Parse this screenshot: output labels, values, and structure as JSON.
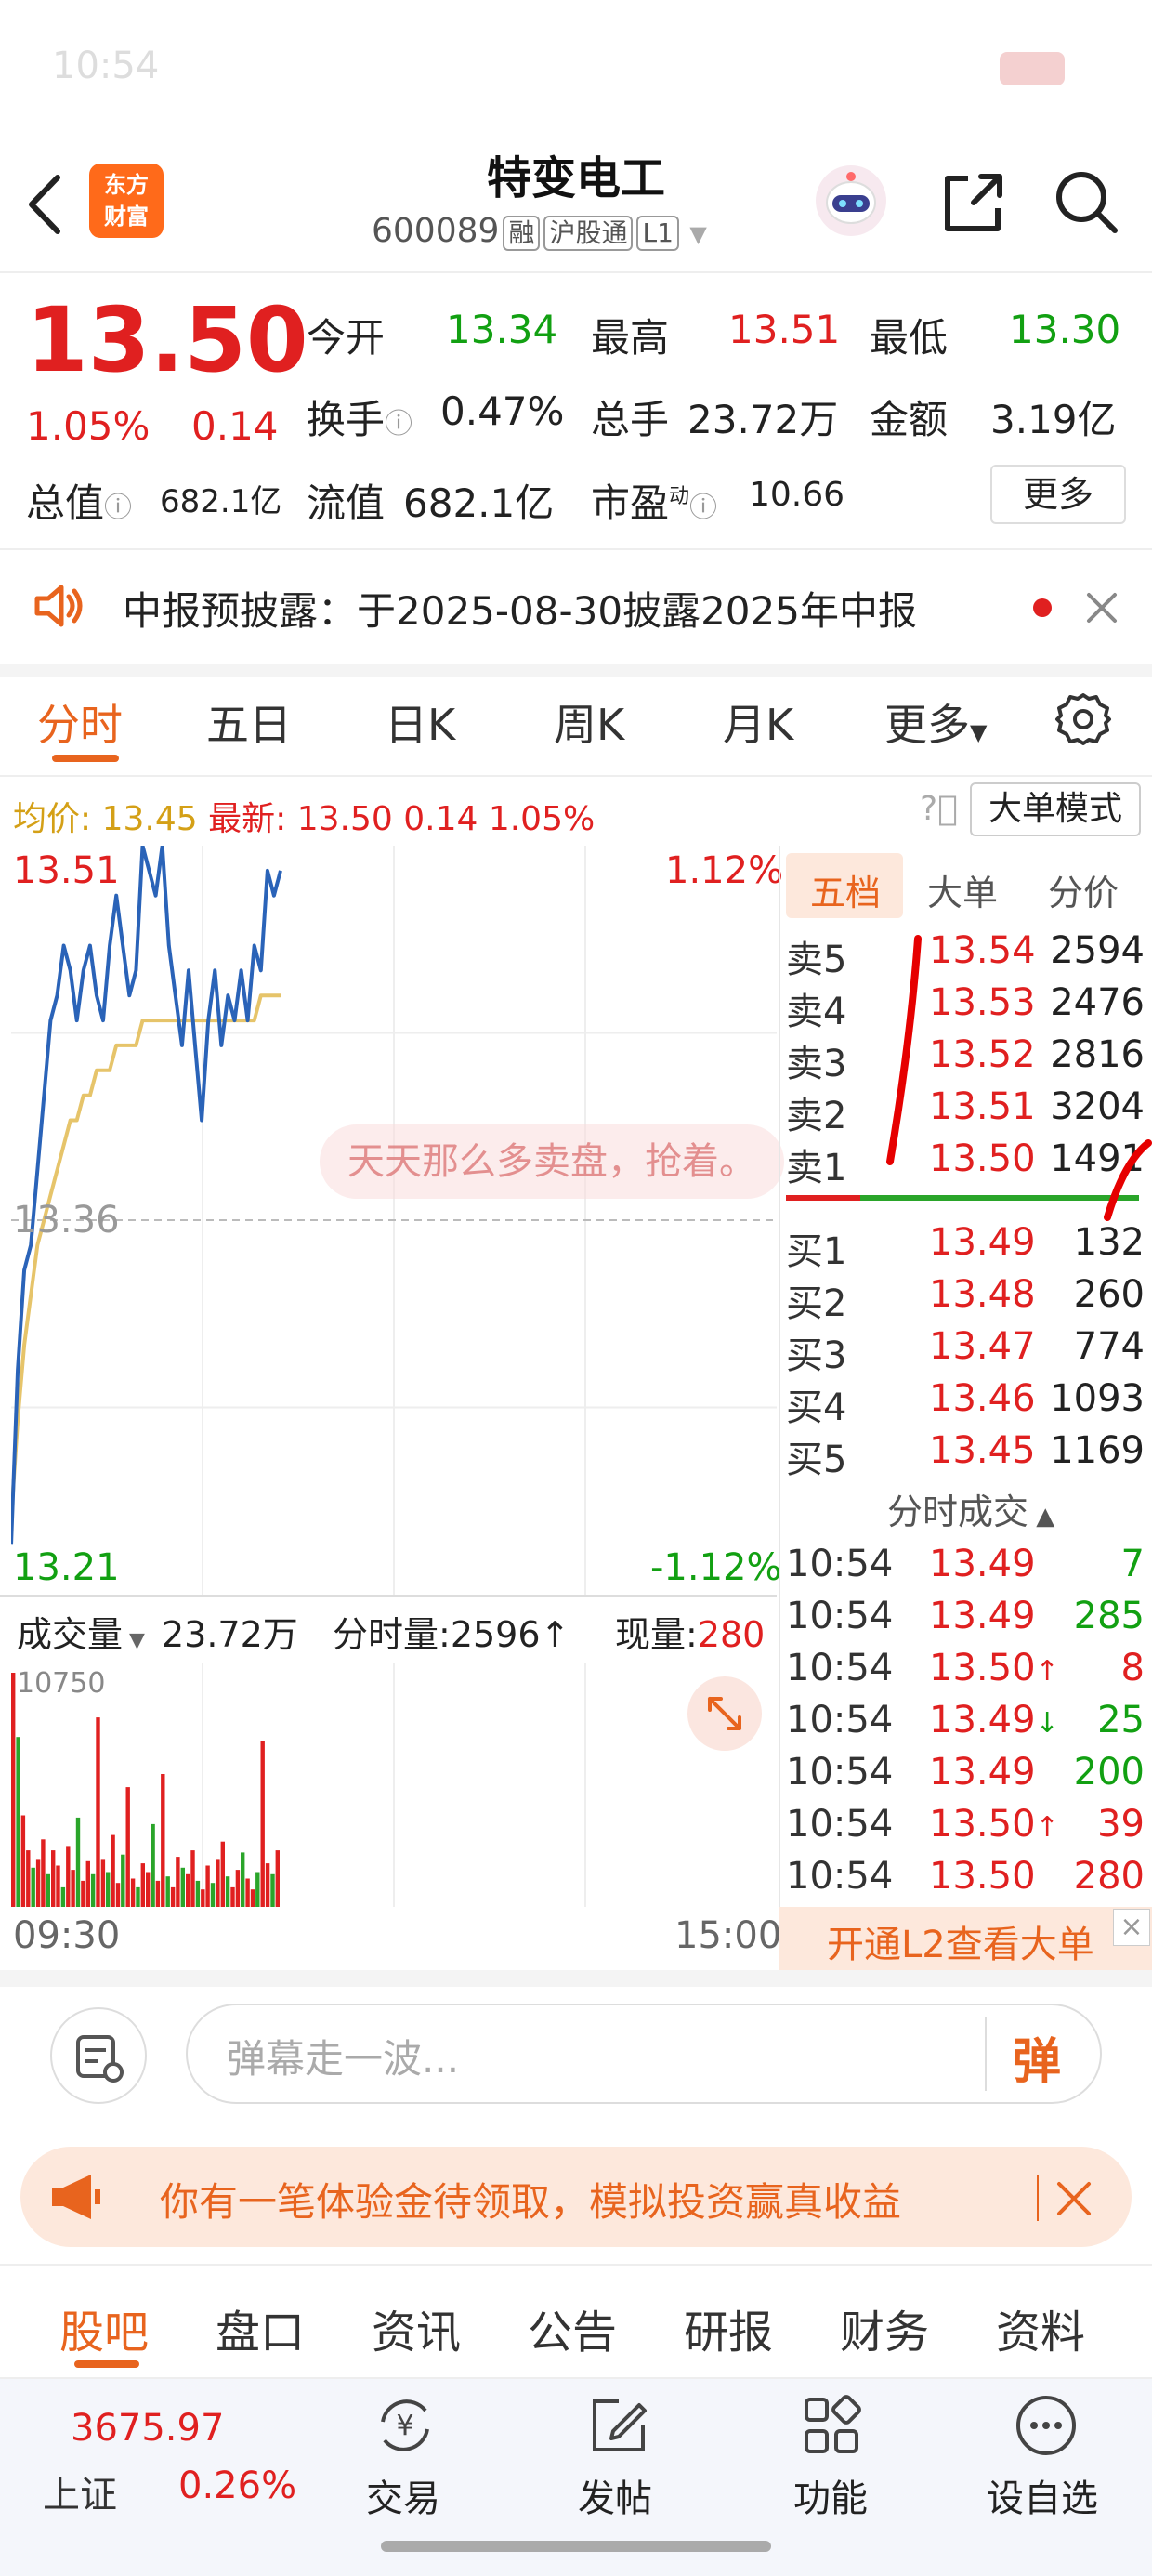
{
  "status_bar": {
    "time": "10:54"
  },
  "header": {
    "logo_text": [
      "东方",
      "财富"
    ],
    "title": "特变电工",
    "code": "600089",
    "tags": [
      "融",
      "沪股通",
      "L1"
    ]
  },
  "quote": {
    "price": "13.50",
    "change_pct": "1.05%",
    "change": "0.14",
    "open_label": "今开",
    "open": "13.34",
    "high_label": "最高",
    "high": "13.51",
    "low_label": "最低",
    "low": "13.30",
    "turnover_label": "换手",
    "turnover": "0.47%",
    "volume_label": "总手",
    "volume": "23.72万",
    "amount_label": "金额",
    "amount": "3.19亿",
    "mktcap_label": "总值",
    "mktcap": "682.1亿",
    "float_label": "流值",
    "float": "682.1亿",
    "pe_label": "市盈",
    "pe_sup": "动",
    "pe": "10.66",
    "more_label": "更多"
  },
  "notice": {
    "text": "中报预披露：于2025-08-30披露2025年中报"
  },
  "chart_tabs": [
    "分时",
    "五日",
    "日K",
    "周K",
    "月K",
    "更多"
  ],
  "chart_header": {
    "avg_label": "均价:",
    "avg": "13.45",
    "latest_label": "最新:",
    "latest": "13.50",
    "latest_change": "0.14",
    "latest_pct": "1.05%",
    "big_order_mode": "大单模式"
  },
  "chart_data": {
    "type": "line",
    "y_axis_left": {
      "top": "13.51",
      "mid": "13.36",
      "bottom": "13.21"
    },
    "y_axis_right": {
      "top": "1.12%",
      "bottom": "-1.12%"
    },
    "x_axis": {
      "start": "09:30",
      "end": "15:00"
    },
    "ylim": [
      13.21,
      13.51
    ],
    "ylabel": "",
    "xlabel": "",
    "series": [
      {
        "name": "",
        "color": "#2a63b8",
        "values": [
          13.23,
          13.3,
          13.34,
          13.35,
          13.38,
          13.41,
          13.44,
          13.45,
          13.47,
          13.46,
          13.44,
          13.46,
          13.47,
          13.45,
          13.44,
          13.47,
          13.49,
          13.47,
          13.45,
          13.46,
          13.51,
          13.5,
          13.49,
          13.51,
          13.47,
          13.45,
          13.43,
          13.46,
          13.43,
          13.4,
          13.44,
          13.46,
          13.43,
          13.45,
          13.44,
          13.46,
          13.44,
          13.47,
          13.46,
          13.5,
          13.49,
          13.5
        ]
      },
      {
        "name": "",
        "color": "#e6c46a",
        "values": [
          13.24,
          13.28,
          13.31,
          13.33,
          13.35,
          13.36,
          13.37,
          13.38,
          13.39,
          13.4,
          13.4,
          13.41,
          13.41,
          13.42,
          13.42,
          13.42,
          13.43,
          13.43,
          13.43,
          13.43,
          13.44,
          13.44,
          13.44,
          13.44,
          13.44,
          13.44,
          13.44,
          13.44,
          13.44,
          13.44,
          13.44,
          13.44,
          13.44,
          13.44,
          13.44,
          13.44,
          13.44,
          13.44,
          13.45,
          13.45,
          13.45,
          13.45
        ]
      }
    ],
    "volume_max": "10750",
    "volume": [
      10750,
      7800,
      4200,
      2600,
      1800,
      2200,
      3100,
      1500,
      2600,
      1900,
      900,
      2800,
      1700,
      4100,
      1200,
      2100,
      1500,
      8700,
      2200,
      1600,
      3300,
      1100,
      2400,
      5500,
      1300,
      900,
      2000,
      1600,
      3800,
      1200,
      6100,
      1400,
      900,
      2300,
      1800,
      1500,
      2600,
      1200,
      800,
      1900,
      1100,
      2200,
      3000,
      1400,
      900,
      1700,
      2500,
      1300,
      800,
      1600,
      7600,
      2000,
      1500,
      2600
    ]
  },
  "watermark": "天天那么多卖盘，抢着。",
  "volume_bar": {
    "label": "成交量",
    "total": "23.72万",
    "minute_label": "分时量:",
    "minute": "2596",
    "minute_arrow": "↑",
    "current_label": "现量:",
    "current": "280"
  },
  "order_book": {
    "tabs": [
      "五档",
      "大单",
      "分价"
    ],
    "asks": [
      {
        "label": "卖5",
        "price": "13.54",
        "qty": "2594"
      },
      {
        "label": "卖4",
        "price": "13.53",
        "qty": "2476"
      },
      {
        "label": "卖3",
        "price": "13.52",
        "qty": "2816"
      },
      {
        "label": "卖2",
        "price": "13.51",
        "qty": "3204"
      },
      {
        "label": "卖1",
        "price": "13.50",
        "qty": "1491"
      }
    ],
    "bids": [
      {
        "label": "买1",
        "price": "13.49",
        "qty": "132"
      },
      {
        "label": "买2",
        "price": "13.48",
        "qty": "260"
      },
      {
        "label": "买3",
        "price": "13.47",
        "qty": "774"
      },
      {
        "label": "买4",
        "price": "13.46",
        "qty": "1093"
      },
      {
        "label": "买5",
        "price": "13.45",
        "qty": "1169"
      }
    ],
    "trades_title": "分时成交",
    "trades": [
      {
        "time": "10:54",
        "price": "13.49",
        "arrow": "",
        "qty": "7",
        "qty_color": "green"
      },
      {
        "time": "10:54",
        "price": "13.49",
        "arrow": "",
        "qty": "285",
        "qty_color": "green"
      },
      {
        "time": "10:54",
        "price": "13.50",
        "arrow": "↑",
        "qty": "8",
        "qty_color": "red"
      },
      {
        "time": "10:54",
        "price": "13.49",
        "arrow": "↓",
        "qty": "25",
        "qty_color": "green"
      },
      {
        "time": "10:54",
        "price": "13.49",
        "arrow": "",
        "qty": "200",
        "qty_color": "green"
      },
      {
        "time": "10:54",
        "price": "13.50",
        "arrow": "↑",
        "qty": "39",
        "qty_color": "red"
      },
      {
        "time": "10:54",
        "price": "13.50",
        "arrow": "",
        "qty": "280",
        "qty_color": "red"
      }
    ],
    "l2_banner": "开通L2查看大单"
  },
  "danmaku": {
    "placeholder": "弹幕走一波...",
    "send_label": "弹"
  },
  "promo": {
    "text": "你有一笔体验金待领取，模拟投资赢真收益"
  },
  "bottom_tabs": [
    "股吧",
    "盘口",
    "资讯",
    "公告",
    "研报",
    "财务",
    "资料"
  ],
  "bottom_nav": {
    "index_value": "3675.97",
    "index_name": "上证",
    "index_pct": "0.26%",
    "items": [
      "交易",
      "发帖",
      "功能",
      "设自选"
    ]
  }
}
